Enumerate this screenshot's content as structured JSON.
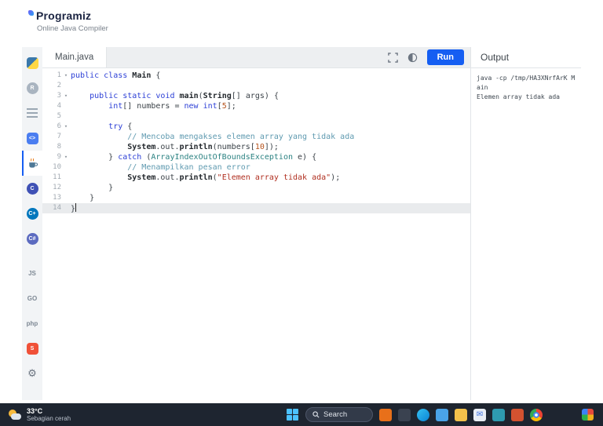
{
  "colors": {
    "accent": "#155ef2",
    "taskbar_bg": "#1e2530"
  },
  "header": {
    "brand": "Programiz",
    "subtitle": "Online Java Compiler"
  },
  "sidebar": {
    "items": [
      {
        "id": "python",
        "kind": "python"
      },
      {
        "id": "r",
        "kind": "circle",
        "glyph": "R",
        "bg": "#a9b4c0"
      },
      {
        "id": "sql",
        "kind": "rows"
      },
      {
        "id": "html",
        "kind": "square",
        "glyph": "<>",
        "bg": "#4a7df0"
      },
      {
        "id": "java",
        "kind": "java",
        "active": true
      },
      {
        "id": "c",
        "kind": "circle",
        "glyph": "C",
        "bg": "#3f51b5"
      },
      {
        "id": "cpp",
        "kind": "circle",
        "glyph": "C+",
        "bg": "#0277bd"
      },
      {
        "id": "csharp",
        "kind": "circle",
        "glyph": "C#",
        "bg": "#5c6bc0"
      },
      {
        "id": "javascript",
        "kind": "text",
        "glyph": "JS",
        "gap": true
      },
      {
        "id": "go",
        "kind": "text",
        "glyph": "GO"
      },
      {
        "id": "php",
        "kind": "text",
        "glyph": "php"
      },
      {
        "id": "swift",
        "kind": "square",
        "glyph": "S",
        "bg": "#f05138"
      },
      {
        "id": "rust",
        "kind": "gear",
        "glyph": "⚙"
      }
    ]
  },
  "editor": {
    "tab_label": "Main.java",
    "run_label": "Run",
    "code_lines": [
      {
        "num": "1",
        "fold": true,
        "tokens": [
          {
            "t": "kw",
            "v": "public"
          },
          {
            "t": "pl",
            "v": " "
          },
          {
            "t": "kw",
            "v": "class"
          },
          {
            "t": "pl",
            "v": " "
          },
          {
            "t": "cls",
            "v": "Main"
          },
          {
            "t": "pl",
            "v": " {"
          }
        ]
      },
      {
        "num": "2",
        "tokens": []
      },
      {
        "num": "3",
        "fold": true,
        "tokens": [
          {
            "t": "pl",
            "v": "    "
          },
          {
            "t": "kw",
            "v": "public"
          },
          {
            "t": "pl",
            "v": " "
          },
          {
            "t": "kw",
            "v": "static"
          },
          {
            "t": "pl",
            "v": " "
          },
          {
            "t": "kw",
            "v": "void"
          },
          {
            "t": "pl",
            "v": " "
          },
          {
            "t": "fn",
            "v": "main"
          },
          {
            "t": "pl",
            "v": "("
          },
          {
            "t": "cls",
            "v": "String"
          },
          {
            "t": "pl",
            "v": "[] args) {"
          }
        ]
      },
      {
        "num": "4",
        "tokens": [
          {
            "t": "pl",
            "v": "        "
          },
          {
            "t": "kw",
            "v": "int"
          },
          {
            "t": "pl",
            "v": "[] numbers = "
          },
          {
            "t": "kw",
            "v": "new"
          },
          {
            "t": "pl",
            "v": " "
          },
          {
            "t": "kw",
            "v": "int"
          },
          {
            "t": "pl",
            "v": "["
          },
          {
            "t": "num",
            "v": "5"
          },
          {
            "t": "pl",
            "v": "];"
          }
        ]
      },
      {
        "num": "5",
        "tokens": []
      },
      {
        "num": "6",
        "fold": true,
        "tokens": [
          {
            "t": "pl",
            "v": "        "
          },
          {
            "t": "kw",
            "v": "try"
          },
          {
            "t": "pl",
            "v": " {"
          }
        ]
      },
      {
        "num": "7",
        "tokens": [
          {
            "t": "pl",
            "v": "            "
          },
          {
            "t": "com",
            "v": "// Mencoba mengakses elemen array yang tidak ada"
          }
        ]
      },
      {
        "num": "8",
        "tokens": [
          {
            "t": "pl",
            "v": "            "
          },
          {
            "t": "cls",
            "v": "System"
          },
          {
            "t": "pl",
            "v": ".out."
          },
          {
            "t": "fn",
            "v": "println"
          },
          {
            "t": "pl",
            "v": "(numbers["
          },
          {
            "t": "num",
            "v": "10"
          },
          {
            "t": "pl",
            "v": "]);"
          }
        ]
      },
      {
        "num": "9",
        "fold": true,
        "tokens": [
          {
            "t": "pl",
            "v": "        } "
          },
          {
            "t": "kw",
            "v": "catch"
          },
          {
            "t": "pl",
            "v": " ("
          },
          {
            "t": "sup",
            "v": "ArrayIndexOutOfBoundsException"
          },
          {
            "t": "pl",
            "v": " e) {"
          }
        ]
      },
      {
        "num": "10",
        "tokens": [
          {
            "t": "pl",
            "v": "            "
          },
          {
            "t": "com",
            "v": "// Menampilkan pesan error"
          }
        ]
      },
      {
        "num": "11",
        "tokens": [
          {
            "t": "pl",
            "v": "            "
          },
          {
            "t": "cls",
            "v": "System"
          },
          {
            "t": "pl",
            "v": ".out."
          },
          {
            "t": "fn",
            "v": "println"
          },
          {
            "t": "pl",
            "v": "("
          },
          {
            "t": "str",
            "v": "\"Elemen array tidak ada\""
          },
          {
            "t": "pl",
            "v": ");"
          }
        ]
      },
      {
        "num": "12",
        "tokens": [
          {
            "t": "pl",
            "v": "        }"
          }
        ]
      },
      {
        "num": "13",
        "tokens": [
          {
            "t": "pl",
            "v": "    }"
          }
        ]
      },
      {
        "num": "14",
        "active": true,
        "tokens": [
          {
            "t": "pl",
            "v": "}"
          }
        ]
      }
    ]
  },
  "output": {
    "title": "Output",
    "lines": [
      "java -cp /tmp/HA3XNrfArK Main",
      "Elemen array tidak ada"
    ]
  },
  "taskbar": {
    "weather": {
      "temp": "33°C",
      "desc": "Sebagian cerah"
    },
    "search_label": "Search",
    "icons": [
      {
        "name": "paint",
        "bg": "#e8701a"
      },
      {
        "name": "monitor",
        "bg": "#3a4250"
      },
      {
        "name": "edge",
        "bg": "linear-gradient(135deg,#35c1f1,#0a84d6)",
        "round": true
      },
      {
        "name": "store",
        "bg": "#4aa3e8"
      },
      {
        "name": "file-explorer",
        "bg": "#f2c14b"
      },
      {
        "name": "mail",
        "bg": "#e8edf4",
        "glyph": "✉",
        "fg": "#3a70e2"
      },
      {
        "name": "settings",
        "bg": "#2e9bb0"
      },
      {
        "name": "powerpoint",
        "bg": "#d35230"
      },
      {
        "name": "chrome",
        "bg": "radial-gradient(circle,#fff 16%,#4285f4 17% 33%,transparent 34%),conic-gradient(#ea4335 0 120deg,#fbbc05 120deg 240deg,#34a853 240deg 360deg)",
        "round": true
      }
    ]
  }
}
